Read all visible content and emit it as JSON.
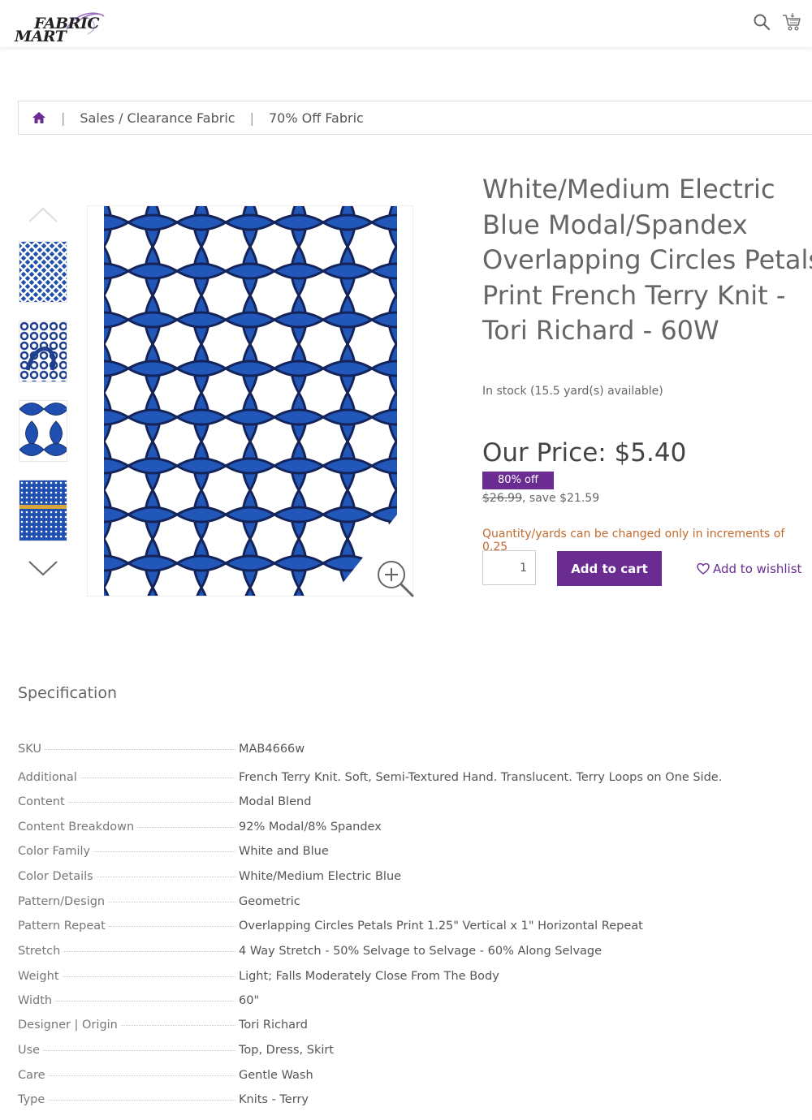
{
  "header": {
    "logo_line1": "FABRIC",
    "logo_line2": "MART",
    "icons": [
      "search-icon",
      "cart-icon"
    ]
  },
  "breadcrumb": {
    "home_icon": "home-icon",
    "items": [
      {
        "label": "Sales / Clearance Fabric"
      },
      {
        "label": "70% Off Fabric"
      }
    ],
    "separator": "|"
  },
  "colors": {
    "brand_purple": "#6a2c91",
    "fabric_blue": "#1f4fb0",
    "note_orange": "#c0692c"
  },
  "product": {
    "title": "White/Medium Electric Blue Modal/Spandex Overlapping Circles Petals Print French Terry Knit - Tori Richard - 60W",
    "stock": "In stock (15.5 yard(s) available)",
    "price_label": "Our Price: $5.40",
    "discount_badge": "80% off",
    "old_price": "$26.99",
    "save_text": ", save $21.59",
    "qty_note": "Quantity/yards can be changed only in increments of 0.25",
    "qty_value": "1",
    "add_to_cart_label": "Add to cart",
    "wishlist_label": "Add to wishlist"
  },
  "specification": {
    "title": "Specification",
    "rows": [
      {
        "label": "SKU",
        "value": "MAB4666w"
      },
      {
        "label": "Additional",
        "value": "French Terry Knit. Soft, Semi-Textured Hand. Translucent. Terry Loops on One Side."
      },
      {
        "label": "Content",
        "value": "Modal Blend"
      },
      {
        "label": "Content Breakdown",
        "value": "92% Modal/8% Spandex"
      },
      {
        "label": "Color Family",
        "value": "White and Blue"
      },
      {
        "label": "Color Details",
        "value": "White/Medium Electric Blue"
      },
      {
        "label": "Pattern/Design",
        "value": "Geometric"
      },
      {
        "label": "Pattern Repeat",
        "value": "Overlapping Circles Petals Print 1.25\" Vertical x 1\" Horizontal Repeat"
      },
      {
        "label": "Stretch",
        "value": "4 Way Stretch - 50% Selvage to Selvage - 60% Along Selvage"
      },
      {
        "label": "Weight",
        "value": "Light; Falls Moderately Close From The Body"
      },
      {
        "label": "Width",
        "value": "60\""
      },
      {
        "label": "Designer | Origin",
        "value": "Tori Richard"
      },
      {
        "label": "Use",
        "value": "Top, Dress, Skirt"
      },
      {
        "label": "Care",
        "value": "Gentle Wash"
      },
      {
        "label": "Type",
        "value": "Knits - Terry"
      }
    ]
  }
}
